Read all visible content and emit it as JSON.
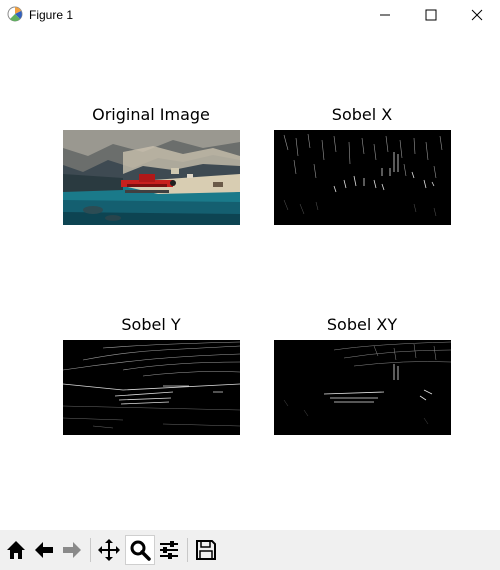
{
  "window": {
    "title": "Figure 1",
    "controls": [
      "minimize-icon",
      "maximize-icon",
      "close-icon"
    ]
  },
  "figure": {
    "subplots": [
      {
        "title": "Original Image",
        "kind": "color-photo"
      },
      {
        "title": "Sobel X",
        "kind": "edge-map"
      },
      {
        "title": "Sobel Y",
        "kind": "edge-map"
      },
      {
        "title": "Sobel XY",
        "kind": "edge-map"
      }
    ]
  },
  "toolbar": {
    "buttons": [
      {
        "name": "home-icon"
      },
      {
        "name": "back-arrow-icon"
      },
      {
        "name": "forward-arrow-icon"
      },
      {
        "name": "pan-icon"
      },
      {
        "name": "zoom-icon",
        "active": true
      },
      {
        "name": "configure-subplots-icon"
      },
      {
        "name": "save-icon"
      }
    ]
  },
  "colors": {
    "background": "#ffffff",
    "toolbar": "#f0f0f0",
    "photo_sky_rock": "#4a5560",
    "photo_water": "#1a7a8a",
    "photo_plane": "#c8201e",
    "edge_background": "#000000",
    "edge_lines": "#d0d0d0"
  }
}
